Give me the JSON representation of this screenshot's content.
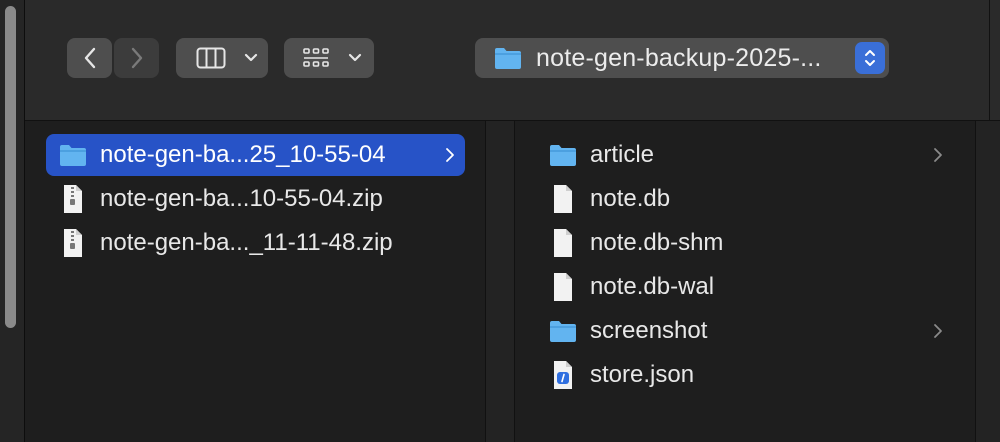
{
  "toolbar": {
    "path_label": "note-gen-backup-2025-..."
  },
  "column1": {
    "items": [
      {
        "name": "note-gen-ba...25_10-55-04",
        "kind": "folder",
        "selected": true,
        "has_children": true
      },
      {
        "name": "note-gen-ba...10-55-04.zip",
        "kind": "zip",
        "selected": false,
        "has_children": false
      },
      {
        "name": "note-gen-ba..._11-11-48.zip",
        "kind": "zip",
        "selected": false,
        "has_children": false
      }
    ]
  },
  "column2": {
    "items": [
      {
        "name": "article",
        "kind": "folder",
        "has_children": true
      },
      {
        "name": "note.db",
        "kind": "file",
        "has_children": false
      },
      {
        "name": "note.db-shm",
        "kind": "file",
        "has_children": false
      },
      {
        "name": "note.db-wal",
        "kind": "file",
        "has_children": false
      },
      {
        "name": "screenshot",
        "kind": "folder",
        "has_children": true
      },
      {
        "name": "store.json",
        "kind": "json",
        "has_children": false
      }
    ]
  },
  "colors": {
    "selection": "#2753c7",
    "folder": "#62b4f0",
    "accent": "#3a6fd8"
  }
}
